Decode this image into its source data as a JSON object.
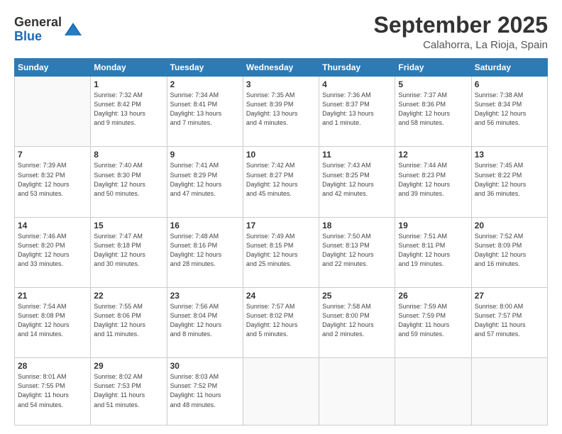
{
  "logo": {
    "general": "General",
    "blue": "Blue"
  },
  "title": "September 2025",
  "subtitle": "Calahorra, La Rioja, Spain",
  "days_header": [
    "Sunday",
    "Monday",
    "Tuesday",
    "Wednesday",
    "Thursday",
    "Friday",
    "Saturday"
  ],
  "weeks": [
    [
      {
        "num": "",
        "info": ""
      },
      {
        "num": "1",
        "info": "Sunrise: 7:32 AM\nSunset: 8:42 PM\nDaylight: 13 hours\nand 9 minutes."
      },
      {
        "num": "2",
        "info": "Sunrise: 7:34 AM\nSunset: 8:41 PM\nDaylight: 13 hours\nand 7 minutes."
      },
      {
        "num": "3",
        "info": "Sunrise: 7:35 AM\nSunset: 8:39 PM\nDaylight: 13 hours\nand 4 minutes."
      },
      {
        "num": "4",
        "info": "Sunrise: 7:36 AM\nSunset: 8:37 PM\nDaylight: 13 hours\nand 1 minute."
      },
      {
        "num": "5",
        "info": "Sunrise: 7:37 AM\nSunset: 8:36 PM\nDaylight: 12 hours\nand 58 minutes."
      },
      {
        "num": "6",
        "info": "Sunrise: 7:38 AM\nSunset: 8:34 PM\nDaylight: 12 hours\nand 56 minutes."
      }
    ],
    [
      {
        "num": "7",
        "info": "Sunrise: 7:39 AM\nSunset: 8:32 PM\nDaylight: 12 hours\nand 53 minutes."
      },
      {
        "num": "8",
        "info": "Sunrise: 7:40 AM\nSunset: 8:30 PM\nDaylight: 12 hours\nand 50 minutes."
      },
      {
        "num": "9",
        "info": "Sunrise: 7:41 AM\nSunset: 8:29 PM\nDaylight: 12 hours\nand 47 minutes."
      },
      {
        "num": "10",
        "info": "Sunrise: 7:42 AM\nSunset: 8:27 PM\nDaylight: 12 hours\nand 45 minutes."
      },
      {
        "num": "11",
        "info": "Sunrise: 7:43 AM\nSunset: 8:25 PM\nDaylight: 12 hours\nand 42 minutes."
      },
      {
        "num": "12",
        "info": "Sunrise: 7:44 AM\nSunset: 8:23 PM\nDaylight: 12 hours\nand 39 minutes."
      },
      {
        "num": "13",
        "info": "Sunrise: 7:45 AM\nSunset: 8:22 PM\nDaylight: 12 hours\nand 36 minutes."
      }
    ],
    [
      {
        "num": "14",
        "info": "Sunrise: 7:46 AM\nSunset: 8:20 PM\nDaylight: 12 hours\nand 33 minutes."
      },
      {
        "num": "15",
        "info": "Sunrise: 7:47 AM\nSunset: 8:18 PM\nDaylight: 12 hours\nand 30 minutes."
      },
      {
        "num": "16",
        "info": "Sunrise: 7:48 AM\nSunset: 8:16 PM\nDaylight: 12 hours\nand 28 minutes."
      },
      {
        "num": "17",
        "info": "Sunrise: 7:49 AM\nSunset: 8:15 PM\nDaylight: 12 hours\nand 25 minutes."
      },
      {
        "num": "18",
        "info": "Sunrise: 7:50 AM\nSunset: 8:13 PM\nDaylight: 12 hours\nand 22 minutes."
      },
      {
        "num": "19",
        "info": "Sunrise: 7:51 AM\nSunset: 8:11 PM\nDaylight: 12 hours\nand 19 minutes."
      },
      {
        "num": "20",
        "info": "Sunrise: 7:52 AM\nSunset: 8:09 PM\nDaylight: 12 hours\nand 16 minutes."
      }
    ],
    [
      {
        "num": "21",
        "info": "Sunrise: 7:54 AM\nSunset: 8:08 PM\nDaylight: 12 hours\nand 14 minutes."
      },
      {
        "num": "22",
        "info": "Sunrise: 7:55 AM\nSunset: 8:06 PM\nDaylight: 12 hours\nand 11 minutes."
      },
      {
        "num": "23",
        "info": "Sunrise: 7:56 AM\nSunset: 8:04 PM\nDaylight: 12 hours\nand 8 minutes."
      },
      {
        "num": "24",
        "info": "Sunrise: 7:57 AM\nSunset: 8:02 PM\nDaylight: 12 hours\nand 5 minutes."
      },
      {
        "num": "25",
        "info": "Sunrise: 7:58 AM\nSunset: 8:00 PM\nDaylight: 12 hours\nand 2 minutes."
      },
      {
        "num": "26",
        "info": "Sunrise: 7:59 AM\nSunset: 7:59 PM\nDaylight: 11 hours\nand 59 minutes."
      },
      {
        "num": "27",
        "info": "Sunrise: 8:00 AM\nSunset: 7:57 PM\nDaylight: 11 hours\nand 57 minutes."
      }
    ],
    [
      {
        "num": "28",
        "info": "Sunrise: 8:01 AM\nSunset: 7:55 PM\nDaylight: 11 hours\nand 54 minutes."
      },
      {
        "num": "29",
        "info": "Sunrise: 8:02 AM\nSunset: 7:53 PM\nDaylight: 11 hours\nand 51 minutes."
      },
      {
        "num": "30",
        "info": "Sunrise: 8:03 AM\nSunset: 7:52 PM\nDaylight: 11 hours\nand 48 minutes."
      },
      {
        "num": "",
        "info": ""
      },
      {
        "num": "",
        "info": ""
      },
      {
        "num": "",
        "info": ""
      },
      {
        "num": "",
        "info": ""
      }
    ]
  ]
}
